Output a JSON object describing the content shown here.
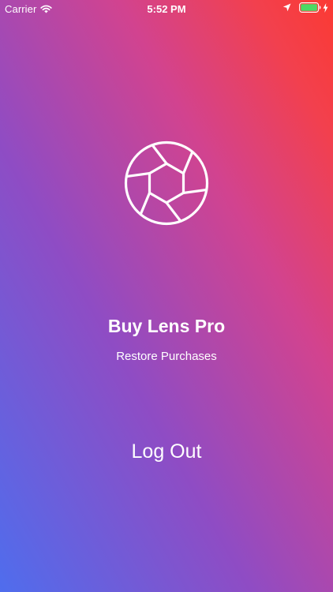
{
  "status_bar": {
    "carrier": "Carrier",
    "time": "5:52 PM",
    "icons": [
      "wifi-icon",
      "location-icon",
      "battery-icon",
      "charging-icon"
    ],
    "battery_color": "#4cd964"
  },
  "logo": {
    "icon": "camera-aperture-icon"
  },
  "actions": {
    "buy_label": "Buy Lens Pro",
    "restore_label": "Restore Purchases",
    "logout_label": "Log Out"
  },
  "colors": {
    "gradient_bottom_left": "#4f6ded",
    "gradient_middle": "#c9459a",
    "gradient_top_right": "#fb3a33",
    "text": "#ffffff"
  }
}
